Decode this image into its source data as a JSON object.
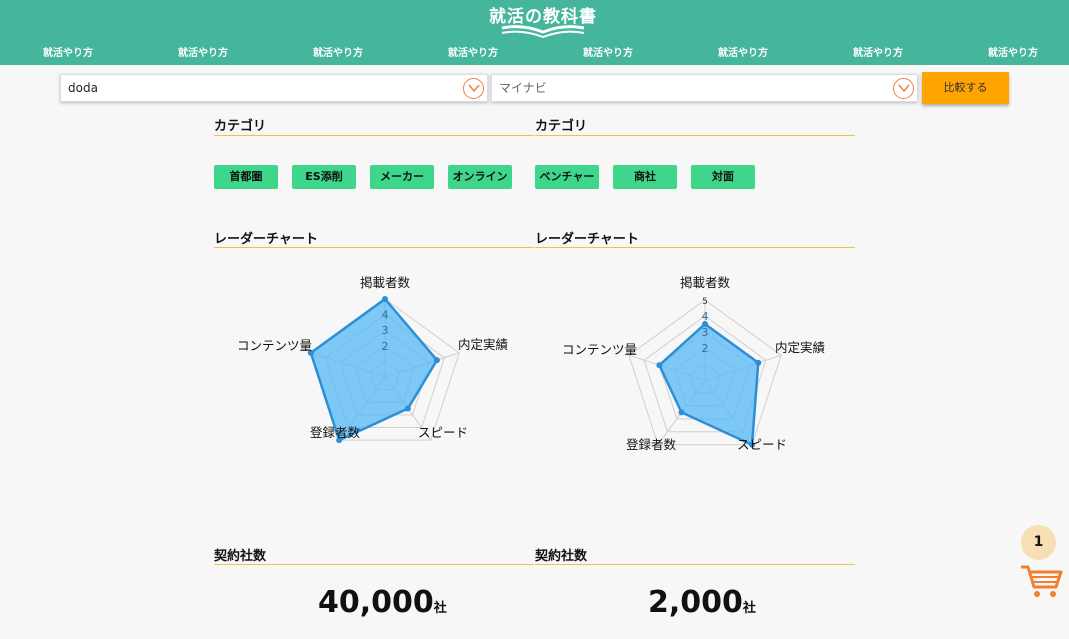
{
  "header": {
    "logo_text": "就活の教科書",
    "nav": [
      "就活やり方",
      "就活やり方",
      "就活やり方",
      "就活やり方",
      "就活やり方",
      "就活やり方",
      "就活やり方",
      "就活やり方"
    ]
  },
  "compare": {
    "left_value": "doda",
    "right_placeholder": "マイナビ",
    "button_label": "比較する"
  },
  "category": {
    "left_title": "カテゴリ",
    "right_title": "カテゴリ",
    "left_tags": [
      "首都圏",
      "ES添削",
      "メーカー",
      "オンライン"
    ],
    "right_tags": [
      "ベンチャー",
      "商社",
      "対面"
    ]
  },
  "radar_section": {
    "left_title": "レーダーチャート",
    "right_title": "レーダーチャート"
  },
  "chart_data": [
    {
      "type": "radar",
      "axes": [
        "掲載者数",
        "内定実績",
        "スピード",
        "登録者数",
        "コンテンツ量"
      ],
      "values": [
        5,
        3.5,
        2.5,
        5,
        5
      ],
      "ticks": [
        "2",
        "3",
        "4"
      ],
      "max": 5
    },
    {
      "type": "radar",
      "axes": [
        "掲載者数",
        "内定実績",
        "スピード",
        "登録者数",
        "コンテンツ量"
      ],
      "values": [
        3.5,
        3.5,
        5,
        2.5,
        3
      ],
      "ticks": [
        "2",
        "3",
        "4"
      ],
      "top_tick": "5",
      "max": 5
    }
  ],
  "contracts": {
    "left_title": "契約社数",
    "right_title": "契約社数",
    "left_value": "40,000",
    "right_value": "2,000",
    "unit": "社"
  },
  "cart": {
    "count": "1"
  },
  "colors": {
    "header": "#45b69c",
    "accent": "#ffa400",
    "tag": "#3ed68a",
    "radar_fill": "#55b8f5",
    "radar_stroke": "#2a8fd6"
  }
}
